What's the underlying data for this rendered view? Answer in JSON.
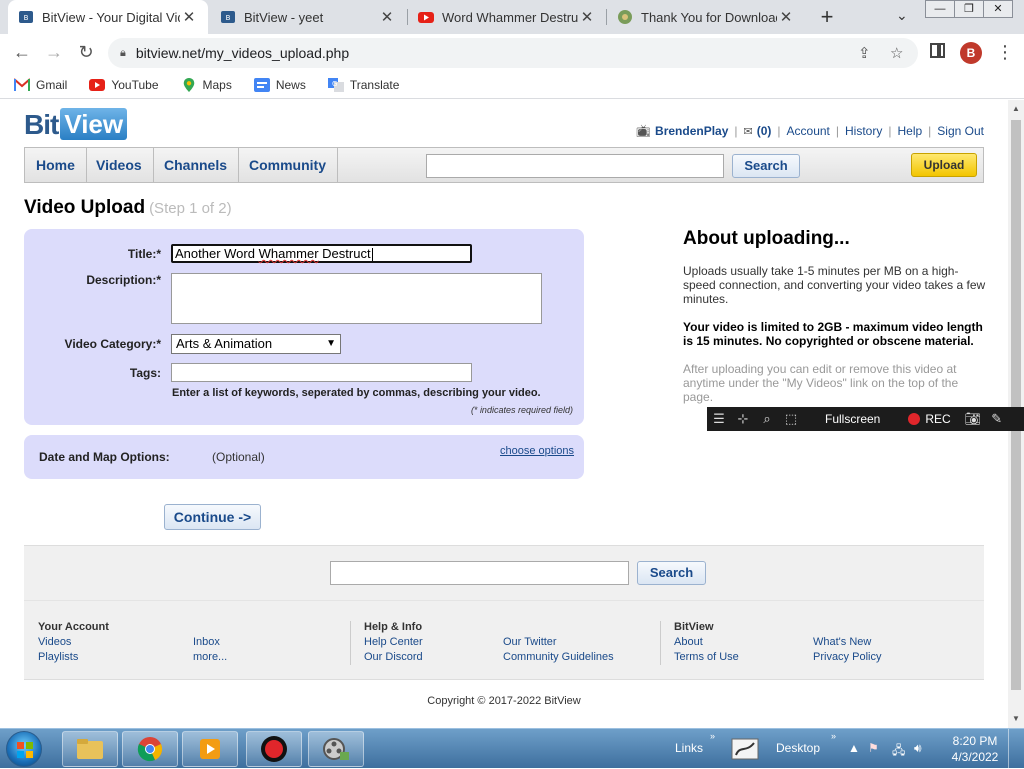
{
  "browser": {
    "tabs": [
      {
        "title": "BitView - Your Digital Video",
        "active": true
      },
      {
        "title": "BitView - yeet",
        "active": false
      },
      {
        "title": "Word Whammer Destruction",
        "active": false
      },
      {
        "title": "Thank You for Downloading",
        "active": false
      }
    ],
    "new_tab": "+",
    "url": "bitview.net/my_videos_upload.php",
    "profile_initial": "B",
    "bookmarks": [
      "Gmail",
      "YouTube",
      "Maps",
      "News",
      "Translate"
    ]
  },
  "site": {
    "logo_bit": "Bit",
    "logo_view": "View",
    "user": {
      "username": "BrendenPlay",
      "inbox_count": "(0)",
      "links": [
        "Account",
        "History",
        "Help",
        "Sign Out"
      ]
    },
    "nav": [
      "Home",
      "Videos",
      "Channels",
      "Community"
    ],
    "search_button": "Search",
    "upload_button": "Upload"
  },
  "upload": {
    "heading": "Video Upload",
    "step": "(Step 1 of 2)",
    "title_label": "Title:*",
    "title_value_plain": "Another Word ",
    "title_value_misspelled": "Whammer",
    "title_value_rest": " Destruct",
    "description_label": "Description:*",
    "category_label": "Video Category:*",
    "category_value": "Arts & Animation",
    "tags_label": "Tags:",
    "tags_hint": "Enter a list of keywords, seperated by commas, describing your video.",
    "required_note": "(* indicates required field)",
    "date_map_label": "Date and Map Options:",
    "date_map_optional": "(Optional)",
    "date_map_link": "choose options",
    "continue_button": "Continue ->"
  },
  "about": {
    "heading": "About uploading...",
    "p1": "Uploads usually take 1-5 minutes per MB on a high-speed connection, and converting your video takes a few minutes.",
    "p2": "Your video is limited to 2GB - maximum video length is 15 minutes. No copyrighted or obscene material.",
    "p3": "After uploading you can edit or remove this video at anytime under the \"My Videos\" link on the top of the page."
  },
  "footer": {
    "search_button": "Search",
    "your_account": {
      "heading": "Your Account",
      "links": [
        "Videos",
        "Playlists",
        "Inbox",
        "more..."
      ]
    },
    "help_info": {
      "heading": "Help & Info",
      "links": [
        "Help Center",
        "Our Discord",
        "Our Twitter",
        "Community Guidelines"
      ]
    },
    "bitview": {
      "heading": "BitView",
      "links": [
        "About",
        "Terms of Use",
        "What's New",
        "Privacy Policy"
      ]
    },
    "copyright": "Copyright © 2017-2022 BitView"
  },
  "recorder": {
    "fullscreen_label": "Fullscreen",
    "rec_label": "REC"
  },
  "taskbar": {
    "links_label": "Links",
    "desktop_label": "Desktop",
    "time": "8:20 PM",
    "date": "4/3/2022"
  },
  "colors": {
    "link_blue": "#1a4a8a",
    "form_panel": "#dcdcfb",
    "upload_yellow": "#f2c500",
    "rec_red": "#e0262b"
  }
}
